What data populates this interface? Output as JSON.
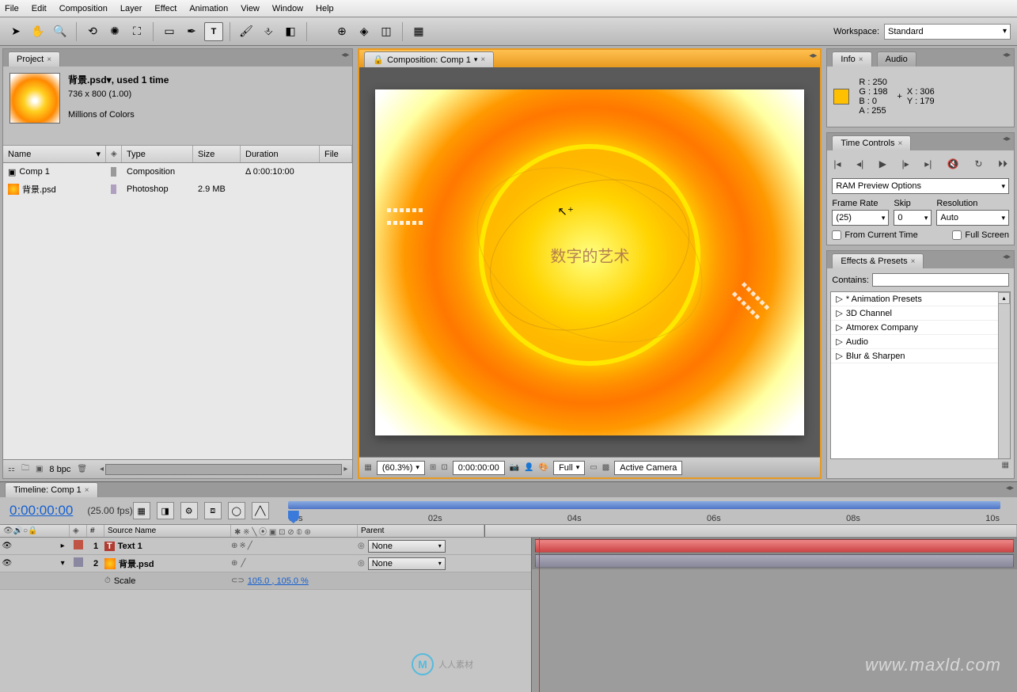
{
  "menubar": [
    "File",
    "Edit",
    "Composition",
    "Layer",
    "Effect",
    "Animation",
    "View",
    "Window",
    "Help"
  ],
  "workspace": {
    "label": "Workspace:",
    "value": "Standard"
  },
  "project": {
    "tab": "Project",
    "asset": {
      "name": "背景.psd▾, used 1 time",
      "dims": "736 x 800 (1.00)",
      "colors": "Millions of Colors"
    },
    "columns": {
      "name": "Name",
      "type": "Type",
      "size": "Size",
      "duration": "Duration",
      "file": "File"
    },
    "rows": [
      {
        "name": "Comp 1",
        "type": "Composition",
        "size": "",
        "duration": "Δ 0:00:10:00",
        "icon": "comp"
      },
      {
        "name": "背景.psd",
        "type": "Photoshop",
        "size": "2.9 MB",
        "duration": "",
        "icon": "psd"
      }
    ],
    "bpc": "8 bpc"
  },
  "composition": {
    "tab": "Composition: Comp 1",
    "overlay_text": "数字的艺术",
    "footer": {
      "zoom": "(60.3%)",
      "time": "0:00:00:00",
      "res": "Full",
      "camera": "Active Camera"
    }
  },
  "info": {
    "tab": "Info",
    "tab2": "Audio",
    "r": "R : 250",
    "g": "G : 198",
    "b": "B : 0",
    "a": "A : 255",
    "x": "X : 306",
    "y": "Y : 179"
  },
  "timecontrols": {
    "tab": "Time Controls",
    "ram": "RAM Preview Options",
    "frameRate": {
      "label": "Frame Rate",
      "value": "(25)"
    },
    "skip": {
      "label": "Skip",
      "value": "0"
    },
    "resolution": {
      "label": "Resolution",
      "value": "Auto"
    },
    "fromCurrent": "From Current Time",
    "fullScreen": "Full Screen"
  },
  "effects": {
    "tab": "Effects & Presets",
    "contains": "Contains:",
    "items": [
      "* Animation Presets",
      "3D Channel",
      "Atmorex Company",
      "Audio",
      "Blur & Sharpen"
    ]
  },
  "timeline": {
    "tab": "Timeline: Comp 1",
    "time": "0:00:00:00",
    "fps": "(25.00 fps)",
    "ruler": [
      "00s",
      "02s",
      "04s",
      "06s",
      "08s",
      "10s"
    ],
    "cols": {
      "source": "Source Name",
      "parent": "Parent",
      "num": "#"
    },
    "layers": [
      {
        "num": "1",
        "name": "Text 1",
        "type": "T",
        "parent": "None",
        "color": "#c05545"
      },
      {
        "num": "2",
        "name": "背景.psd",
        "type": "img",
        "parent": "None",
        "color": "#8a88a0"
      }
    ],
    "scale": {
      "label": "Scale",
      "value": "105.0 , 105.0 %"
    }
  },
  "watermark": {
    "site": "www.maxld.com",
    "brand": "人人素材"
  }
}
